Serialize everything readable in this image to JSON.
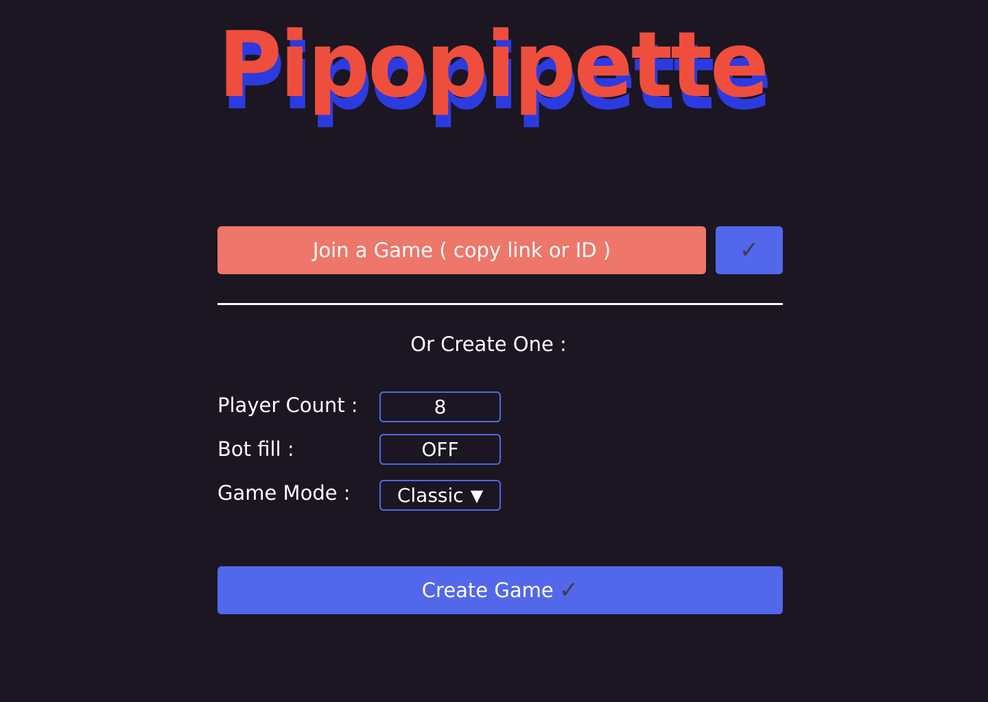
{
  "logo": {
    "text": "Pipopipette",
    "front_color": "#ef4e3d",
    "shadow_color": "#2c3be0"
  },
  "join": {
    "placeholder": "Join a Game ( copy link or ID )",
    "submit_icon": "✓"
  },
  "create": {
    "heading": "Or Create One :",
    "player_count_label": "Player Count :",
    "player_count_value": "8",
    "bot_fill_label": "Bot fill :",
    "bot_fill_value": "OFF",
    "game_mode_label": "Game Mode :",
    "game_mode_value": "Classic",
    "game_mode_arrow": "▼",
    "button_label": "Create Game",
    "button_icon": "✓"
  },
  "colors": {
    "background": "#1b1622",
    "join_input_bg": "#ee766b",
    "accent_blue": "#5367ea"
  }
}
